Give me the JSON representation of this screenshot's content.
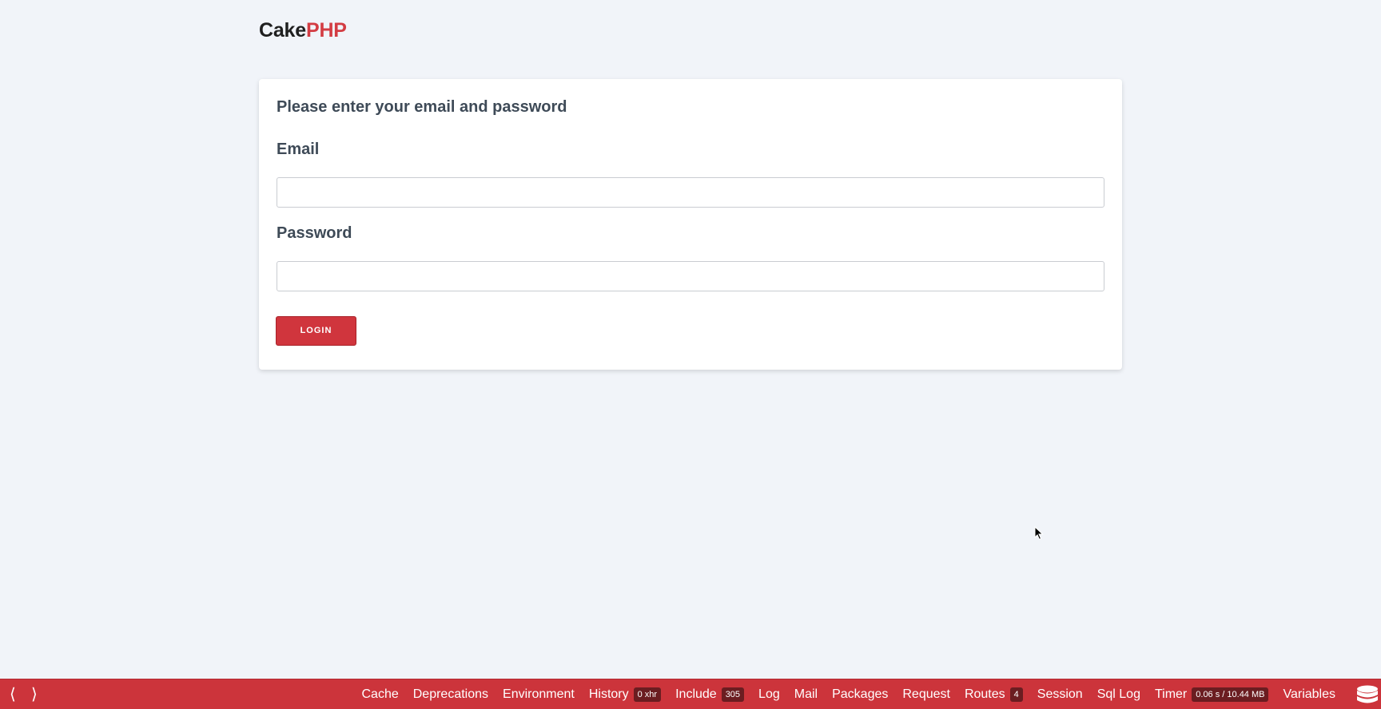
{
  "brand": {
    "part1": "Cake",
    "part2": "PHP"
  },
  "login_form": {
    "title": "Please enter your email and password",
    "email_label": "Email",
    "email_value": "",
    "password_label": "Password",
    "password_value": "",
    "submit_label": "LOGIN"
  },
  "debug_toolbar": {
    "prev_icon": "⟨",
    "next_icon": "⟩",
    "items": [
      {
        "label": "Cache",
        "badge": ""
      },
      {
        "label": "Deprecations",
        "badge": ""
      },
      {
        "label": "Environment",
        "badge": ""
      },
      {
        "label": "History",
        "badge": "0 xhr"
      },
      {
        "label": "Include",
        "badge": "305"
      },
      {
        "label": "Log",
        "badge": ""
      },
      {
        "label": "Mail",
        "badge": ""
      },
      {
        "label": "Packages",
        "badge": ""
      },
      {
        "label": "Request",
        "badge": ""
      },
      {
        "label": "Routes",
        "badge": "4"
      },
      {
        "label": "Session",
        "badge": ""
      },
      {
        "label": "Sql Log",
        "badge": ""
      },
      {
        "label": "Timer",
        "badge": "0.06 s / 10.44 MB"
      },
      {
        "label": "Variables",
        "badge": ""
      }
    ]
  },
  "colors": {
    "background": "#f1f4f9",
    "brand_red": "#d33c43",
    "toolbar_red": "#cc343b",
    "button_red": "#d0353d"
  }
}
